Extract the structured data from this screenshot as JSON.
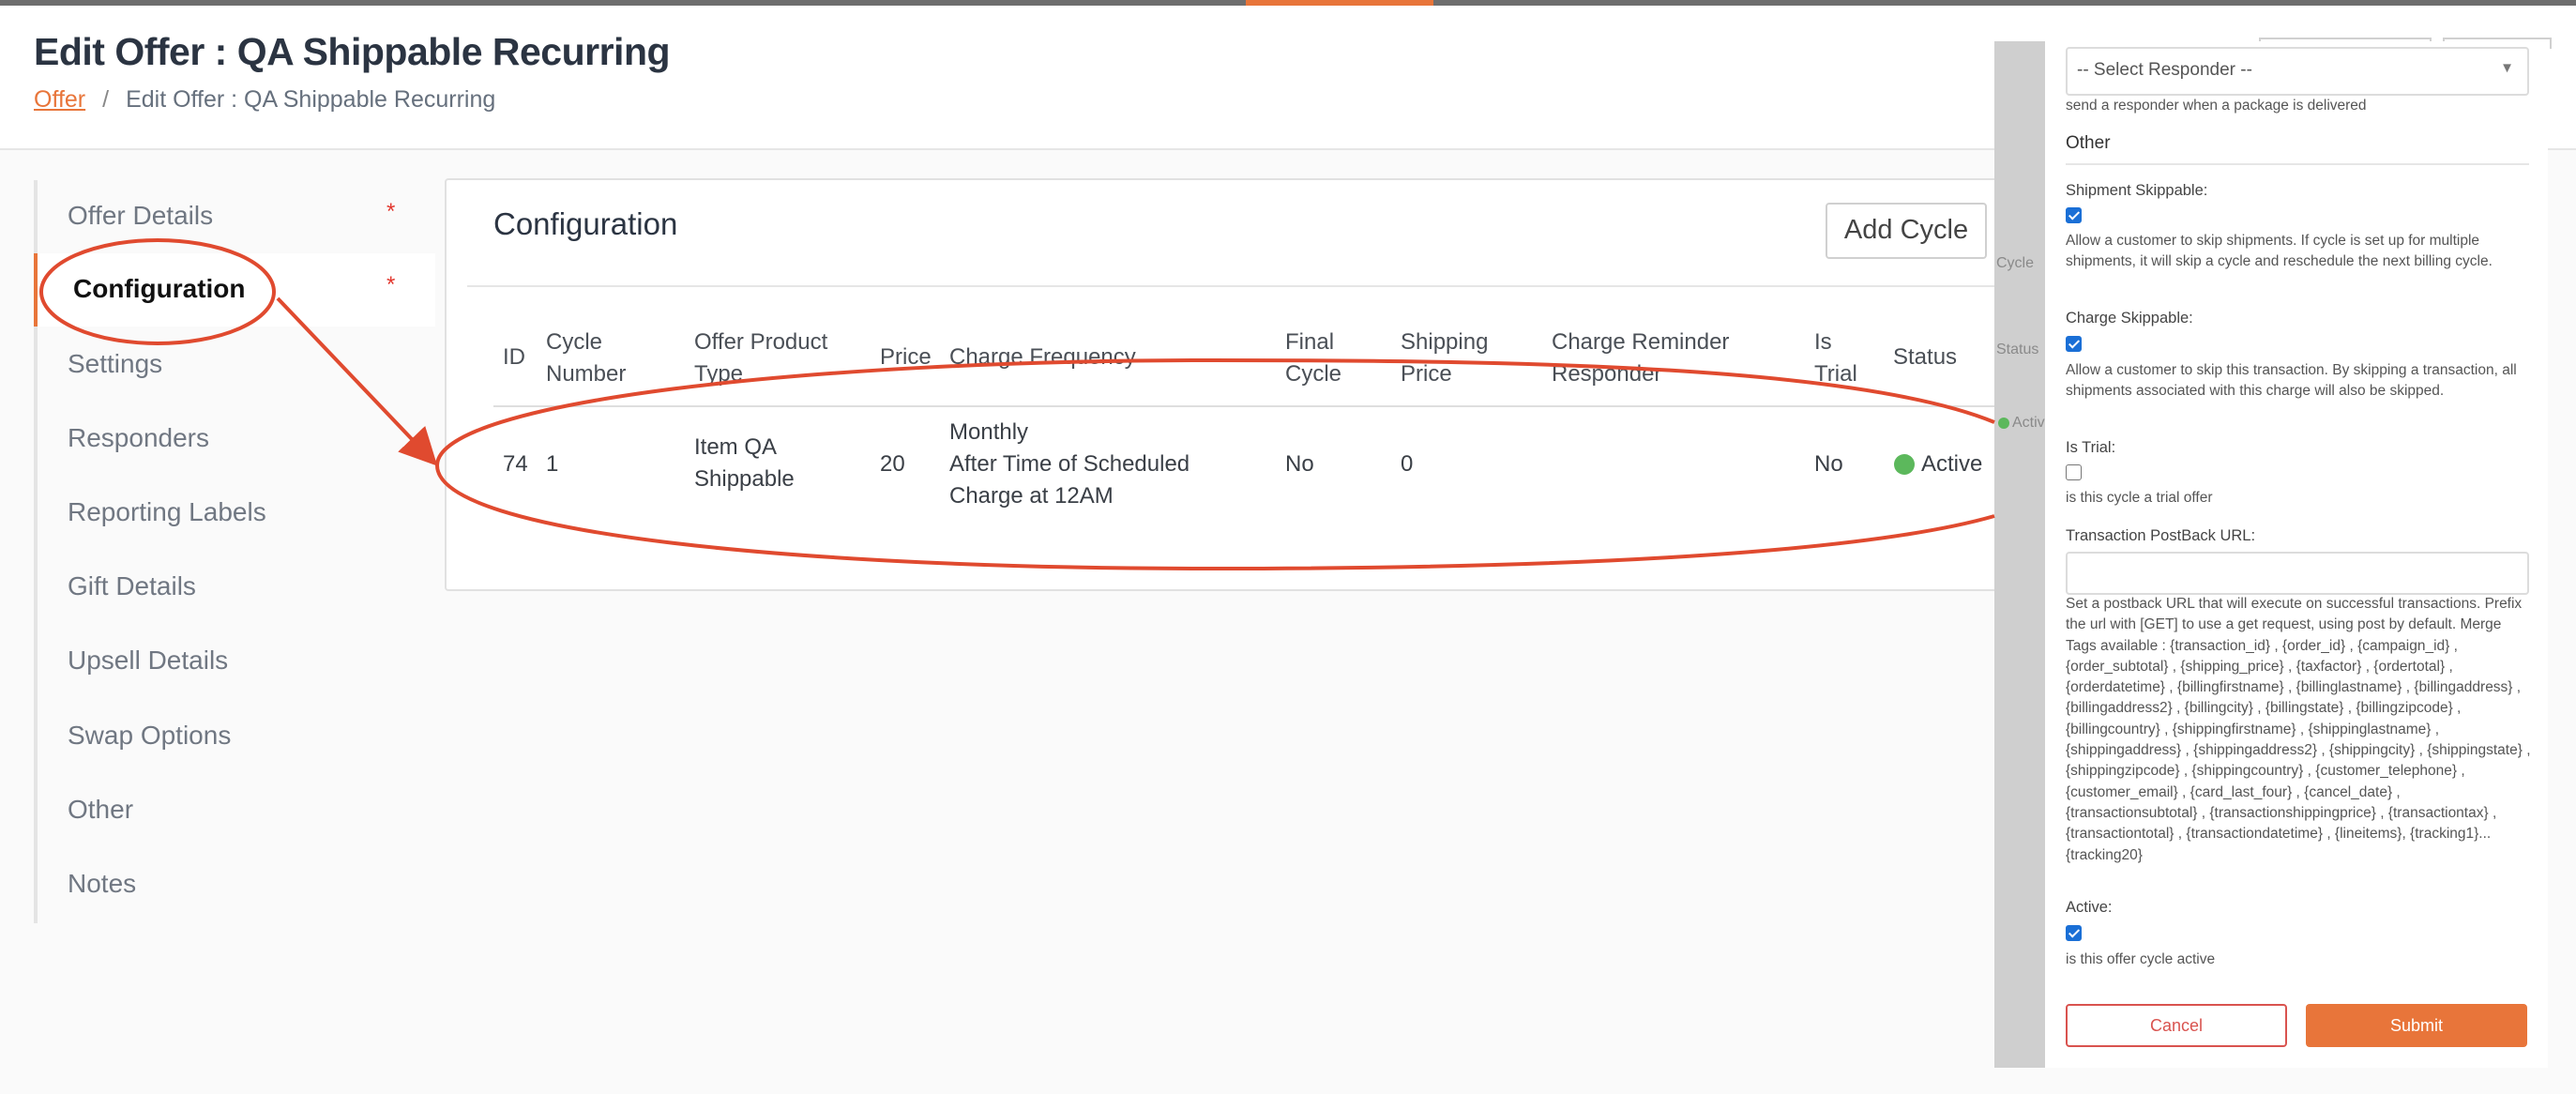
{
  "page": {
    "title": "Edit Offer : QA Shippable Recurring",
    "breadcrumb": {
      "link": "Offer",
      "separator": "/",
      "current": "Edit Offer : QA Shippable Recurring"
    }
  },
  "sidebar": {
    "items": [
      {
        "label": "Offer Details",
        "required": "*"
      },
      {
        "label": "Configuration",
        "required": "*"
      },
      {
        "label": "Settings"
      },
      {
        "label": "Responders"
      },
      {
        "label": "Reporting Labels"
      },
      {
        "label": "Gift Details"
      },
      {
        "label": "Upsell Details"
      },
      {
        "label": "Swap Options"
      },
      {
        "label": "Other"
      },
      {
        "label": "Notes"
      }
    ]
  },
  "config": {
    "title": "Configuration",
    "add_button": "Add Cycle",
    "columns": {
      "id": "ID",
      "cycle_number": [
        "Cycle",
        "Number"
      ],
      "product_type": [
        "Offer Product",
        "Type"
      ],
      "price": "Price",
      "charge_frequency": "Charge Frequency",
      "final_cycle": [
        "Final",
        "Cycle"
      ],
      "shipping_price": [
        "Shipping",
        "Price"
      ],
      "reminder": [
        "Charge Reminder",
        "Responder"
      ],
      "is_trial": [
        "Is",
        "Trial"
      ],
      "status": "Status"
    },
    "rows": [
      {
        "id": "74",
        "cycle_number": "1",
        "product_type": [
          "Item QA",
          "Shippable"
        ],
        "price": "20",
        "charge_frequency": [
          "Monthly",
          "After Time of Scheduled",
          "Charge at 12AM"
        ],
        "final_cycle": "No",
        "shipping_price": "0",
        "is_trial": "No",
        "status": "Active",
        "status_color": "#5cb85c"
      }
    ]
  },
  "overlay_fragments": {
    "cycle": "Cycle",
    "status": "Status",
    "active": "Activ"
  },
  "panel": {
    "responder_select": {
      "value": "-- Select Responder --"
    },
    "responder_help": "send a responder when a package is delivered",
    "section": "Other",
    "shipment_skippable": {
      "label": "Shipment Skippable:",
      "checked": true,
      "help": "Allow a customer to skip shipments. If cycle is set up for multiple shipments, it will skip a cycle and reschedule the next billing cycle."
    },
    "charge_skippable": {
      "label": "Charge Skippable:",
      "checked": true,
      "help": "Allow a customer to skip this transaction. By skipping a transaction, all shipments associated with this charge will also be skipped."
    },
    "is_trial": {
      "label": "Is Trial:",
      "checked": false,
      "help": "is this cycle a trial offer"
    },
    "postback": {
      "label": "Transaction PostBack URL:",
      "value": "",
      "help": "Set a postback URL that will execute on successful transactions. Prefix the url with [GET] to use a get request, using post by default. Merge Tags available : {transaction_id} , {order_id} , {campaign_id} , {order_subtotal} , {shipping_price} , {taxfactor} , {ordertotal} , {orderdatetime} , {billingfirstname} , {billinglastname} , {billingaddress} , {billingaddress2} , {billingcity} , {billingstate} , {billingzipcode} , {billingcountry} , {shippingfirstname} , {shippinglastname} , {shippingaddress} , {shippingaddress2} , {shippingcity} , {shippingstate} , {shippingzipcode} , {shippingcountry} , {customer_telephone} , {customer_email} , {card_last_four} , {cancel_date} , {transactionsubtotal} , {transactionshippingprice} , {transactiontax} , {transactiontotal} , {transactiondatetime} , {lineitems}, {tracking1}...{tracking20}"
    },
    "active": {
      "label": "Active:",
      "checked": true,
      "help": "is this offer cycle active"
    },
    "cancel": "Cancel",
    "submit": "Submit"
  },
  "colors": {
    "accent": "#e8753a",
    "annotation": "#e04a2f",
    "checkbox": "#1a6fd6",
    "danger": "#d9534f"
  }
}
